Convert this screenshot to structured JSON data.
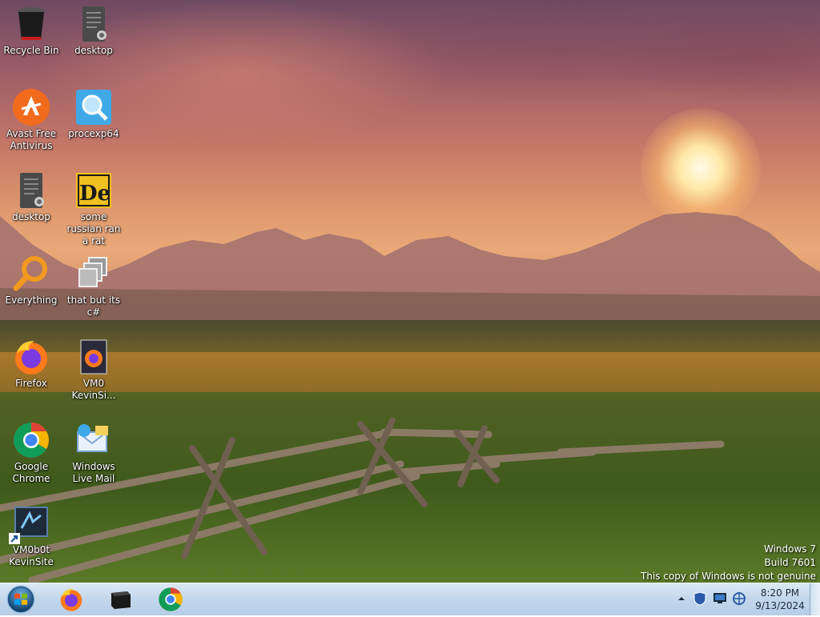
{
  "desktop": {
    "icons": [
      {
        "label": "Recycle Bin",
        "icon": "recycle-bin-icon"
      },
      {
        "label": "desktop",
        "icon": "shortcut-file-icon"
      },
      {
        "label": "Avast Free Antivirus",
        "icon": "avast-icon"
      },
      {
        "label": "procexp64",
        "icon": "process-explorer-icon"
      },
      {
        "label": "desktop",
        "icon": "shortcut-file-icon"
      },
      {
        "label": "some russian ran a rat",
        "icon": "de-app-icon"
      },
      {
        "label": "Everything",
        "icon": "everything-search-icon"
      },
      {
        "label": "that but its c#",
        "icon": "copy-windows-icon"
      },
      {
        "label": "Firefox",
        "icon": "firefox-icon"
      },
      {
        "label": "VM0 KevinSi...",
        "icon": "firefox-file-icon"
      },
      {
        "label": "Google Chrome",
        "icon": "chrome-icon"
      },
      {
        "label": "Windows Live Mail",
        "icon": "windows-live-mail-icon"
      },
      {
        "label": "VM0b0t KevinSite",
        "icon": "vm-bot-icon"
      }
    ]
  },
  "watermark": {
    "line1": "Windows 7",
    "line2": "Build 7601",
    "line3": "This copy of Windows is not genuine"
  },
  "taskbar": {
    "pinned": [
      {
        "icon": "firefox-icon"
      },
      {
        "icon": "terminal-icon"
      },
      {
        "icon": "chrome-icon"
      }
    ],
    "tray": [
      "show-hidden-icons-arrow",
      "security-shield-icon",
      "action-center-icon",
      "network-icon"
    ],
    "clock": {
      "time": "8:20 PM",
      "date": "9/13/2024"
    }
  }
}
